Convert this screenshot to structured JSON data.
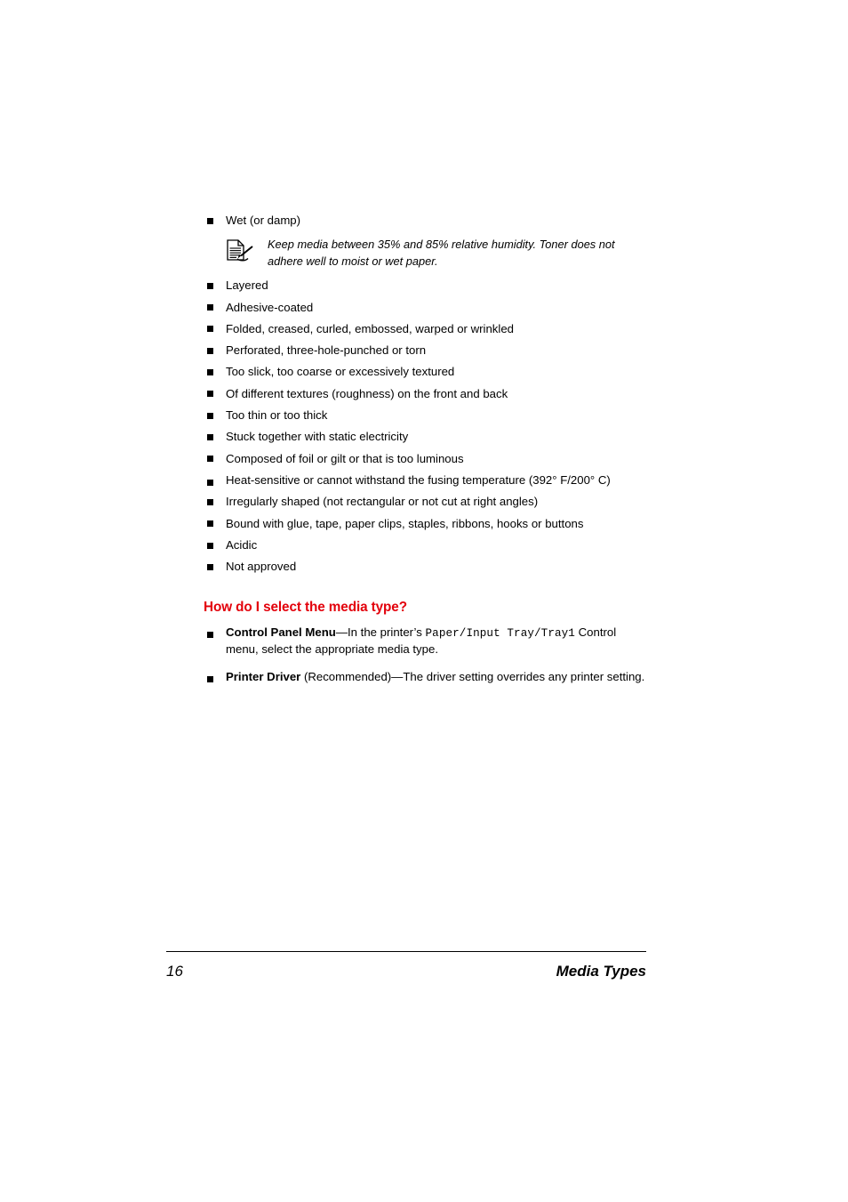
{
  "document": {
    "page_number": "16",
    "footer_title": "Media Types"
  },
  "colors": {
    "heading_red": "#E3000B",
    "body_text": "#000000",
    "page_background": "#FFFFFF"
  },
  "avoid_media_list": {
    "items": [
      {
        "text": "Wet (or damp)"
      },
      {
        "text": "Layered"
      },
      {
        "text": "Adhesive-coated"
      },
      {
        "text": "Folded, creased, curled, embossed, warped or wrinkled"
      },
      {
        "text": "Perforated, three-hole-punched or torn"
      },
      {
        "text": "Too slick, too coarse or excessively textured"
      },
      {
        "text": "Of different textures (roughness) on the front and back"
      },
      {
        "text": "Too thin or too thick"
      },
      {
        "text": "Stuck together with static electricity"
      },
      {
        "text": "Composed of foil or gilt or that is too luminous"
      },
      {
        "text": "Heat-sensitive or cannot withstand the fusing temperature (392° F/200° C)"
      },
      {
        "text": "Irregularly shaped (not rectangular or not cut at right angles)"
      },
      {
        "text": "Bound with glue, tape, paper clips, staples, ribbons, hooks or buttons"
      },
      {
        "text": "Acidic"
      },
      {
        "text": "Not approved"
      }
    ]
  },
  "note": {
    "icon": "note-document-pen-icon",
    "text": "Keep media between 35% and 85% relative humidity. Toner does not adhere well to moist or wet paper."
  },
  "media_type_section": {
    "heading": "How do I select the media type?",
    "items": [
      {
        "label": "Control Panel Menu",
        "text_before_mono": "—In the printer’s ",
        "mono": "Paper/Input  Tray/Tray1",
        "text_after_mono": " Control menu, select the appropriate media type."
      },
      {
        "label": "Printer Driver",
        "text_before_mono": " (Recommended)—The driver setting overrides any printer setting.",
        "mono": "",
        "text_after_mono": ""
      }
    ]
  }
}
